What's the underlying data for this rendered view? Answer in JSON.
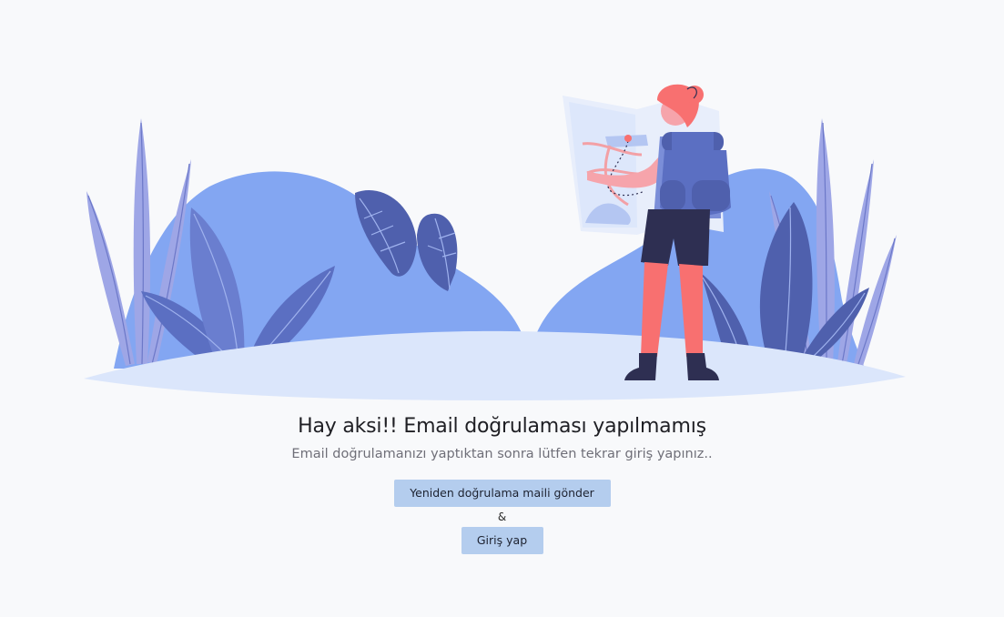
{
  "message": {
    "title": "Hay aksi!! Email doğrulaması yapılmamış",
    "subtitle": "Email doğrulamanızı yaptıktan sonra lütfen tekrar giriş yapınız.."
  },
  "actions": {
    "resend_label": "Yeniden doğrulama maili gönder",
    "separator": "&",
    "login_label": "Giriş yap"
  },
  "illustration": {
    "subject": "hiker-with-map-and-backpack",
    "colors": {
      "ground": "#dbe6fb",
      "bush": "#83a6f2",
      "leaf_light": "#9ea6e6",
      "leaf_dark": "#4f60ad",
      "hair": "#f87070",
      "backpack": "#5b6fc2",
      "shorts": "#2e2f52"
    }
  },
  "theme": {
    "background": "#f8f9fb",
    "button_bg": "#b4cdee"
  }
}
